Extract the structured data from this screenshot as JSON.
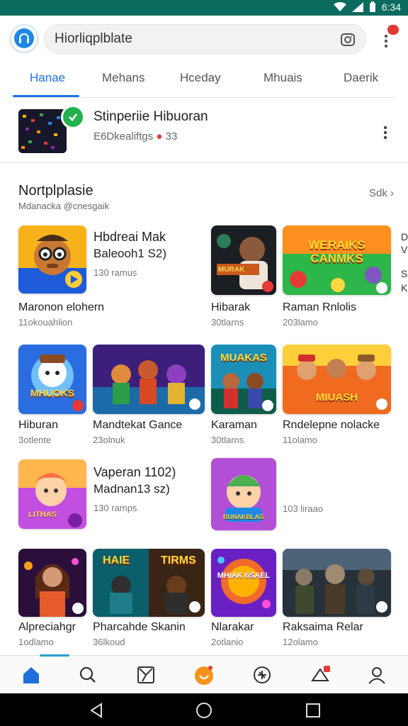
{
  "status_bar": {
    "time": "6:34"
  },
  "search": {
    "value": "Hiorliqplblate"
  },
  "notifications": {
    "badge": ""
  },
  "tabs": [
    {
      "label": "Hanae",
      "active": true
    },
    {
      "label": "Mehans",
      "active": false
    },
    {
      "label": "Hceday",
      "active": false
    },
    {
      "label": "Mhuais",
      "active": false
    },
    {
      "label": "Daerik",
      "active": false
    }
  ],
  "featured": {
    "title": "Stinperiie Hibuoran",
    "subtitle": "E6Dkealiftgs",
    "size": "33"
  },
  "section": {
    "title": "Nortplplasie",
    "subtitle": "Mdanacka @cnesgaik",
    "see_all": "Sdk"
  },
  "games": {
    "r1c1": {
      "title_line1": "Hbdreai Mak",
      "title_line2": "Baleooh1 S2)",
      "meta": "130 ramus",
      "label": "Maronon elohern",
      "sub": "11okouahlion"
    },
    "r1c3": {
      "label": "Hibarak",
      "sub": "30tlarns",
      "banner": "MURAK"
    },
    "r1c4": {
      "label": "Raman Rnlolis",
      "sub": "203lamo",
      "banner": "WERAIKS CANMKS"
    },
    "r2c1": {
      "label": "Hiburan",
      "sub": "3otlente",
      "banner": "MHUOKS"
    },
    "r2c2": {
      "label": "Mandtekat Gance",
      "sub": "23olnuk"
    },
    "r2c3": {
      "label": "Karaman",
      "sub": "30tlarns",
      "banner": "MUAKAS"
    },
    "r2c4": {
      "label": "Rndelepne nolacke",
      "sub": "11olamo",
      "banner": "MIUASH"
    },
    "r3c1": {
      "title_line1": "Vaperan 1102)",
      "title_line2": "Madnan13 sz)",
      "meta": "130 ramps",
      "banner": "LITHAS"
    },
    "r3c3": {
      "meta": "103 liraao",
      "banner": "BUNAKBLAG"
    },
    "r4c1": {
      "label": "Alpreciahgr",
      "sub": "1odlamo"
    },
    "r4c2": {
      "label": "Pharcahde Skanin",
      "sub": "36lkoud",
      "banner_left": "HAIE",
      "banner_right": "TIRMS"
    },
    "r4c3": {
      "label": "Nlarakar",
      "sub": "2otlanio",
      "banner": "MHIAK 6SAEL"
    },
    "r4c4": {
      "label": "Raksaima Relar",
      "sub": "12olamo"
    }
  },
  "peek": [
    "D",
    "V",
    "S",
    "K"
  ],
  "bottom_nav": [
    {
      "name": "home",
      "active": true
    },
    {
      "name": "search"
    },
    {
      "name": "games"
    },
    {
      "name": "hub"
    },
    {
      "name": "activity"
    },
    {
      "name": "alerts"
    },
    {
      "name": "profile"
    }
  ]
}
